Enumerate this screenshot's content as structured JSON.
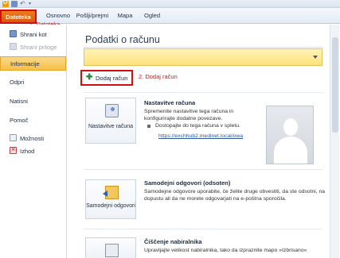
{
  "tabs": {
    "file": "Datoteka",
    "home": "Osnovno",
    "send_receive": "Pošlji/prejmi",
    "folder": "Mapa",
    "view": "Ogled"
  },
  "annotations": {
    "step1": "1. Datoteka",
    "step2": "2. Dodaj račun"
  },
  "nav": {
    "save_as": "Shrani kot",
    "save_attachments": "Shrani priloge",
    "info": "Informacije",
    "open": "Odpri",
    "print": "Natisni",
    "help": "Pomoč",
    "options": "Možnosti",
    "exit": "Izhod"
  },
  "main": {
    "title": "Podatki o računu",
    "add_account": "Dodaj račun",
    "account_settings": {
      "button": "Nastavitve računa",
      "title": "Nastavitve računa",
      "text": "Spremenite nastavitve tega računa in konfigurirajte dodatne povezave.",
      "bullet": "Dostopajte do tega računa v spletu.",
      "link": "https://exchhub2.medinet.local/owa"
    },
    "auto_replies": {
      "button": "Samodejni odgovori",
      "title": "Samodejni odgovori (odsoten)",
      "text": "Samodejne odgovore uporabite, če želite druge obvestiti, da ste odsotni, na dopustu ali da ne morete odgovarjati na e-poštna sporočila."
    },
    "cleanup": {
      "title": "Čiščenje nabiralnika",
      "text": "Upravljajte velikost nabiralnika, tako da izpraznite mapo »Izbrisano«"
    }
  },
  "colors": {
    "file_tab": "#d65a0c",
    "highlight_outline": "#d20f0f",
    "selected_nav": "#f6bf46",
    "account_bar": "#fde27a"
  }
}
